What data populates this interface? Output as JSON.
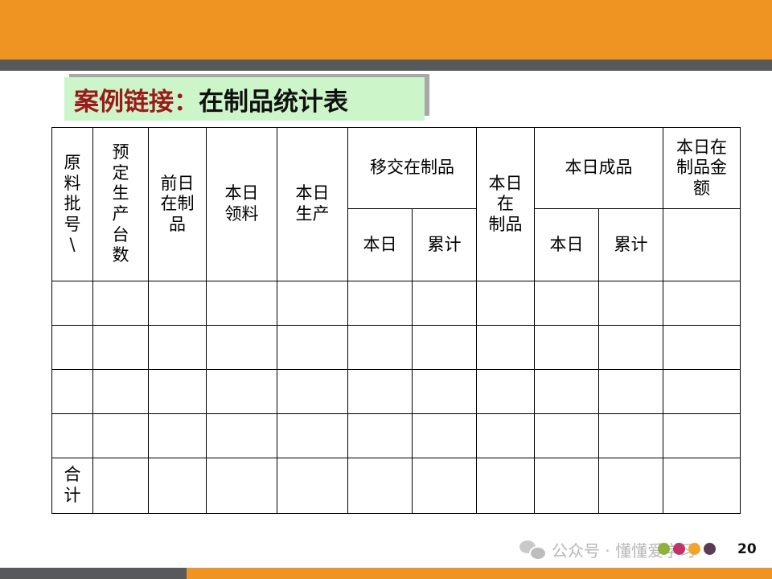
{
  "slide": {
    "title_part1": "案例链接：",
    "title_part2": "在制品统计表",
    "page_number": "20"
  },
  "table": {
    "col_batch": "原\n料\n批\n号\n\\",
    "col_planned": "预\n定\n生\n产\n台\n数",
    "col_prev_wip": "前日\n在制\n品",
    "col_material": "本日\n领料",
    "col_production": "本日\n生产",
    "col_transfer": "移交在制品",
    "col_transfer_today": "本日",
    "col_transfer_total": "累计",
    "col_today_wip": "本日\n在\n制品",
    "col_finished": "本日成品",
    "col_finished_today": "本日",
    "col_finished_total": "累计",
    "col_wip_amount": "本日在\n制品金\n额",
    "total_label": "合\n计"
  },
  "watermark": {
    "text": "公众号 · 懂懂爱学习"
  },
  "colors": {
    "accent_orange": "#ef9322",
    "stripe_gray": "#58595b",
    "title_bg": "#ccf5c9",
    "title_red": "#9b1b1b",
    "dots": [
      "#8db33a",
      "#c2336a",
      "#efa42c",
      "#5b3a55"
    ]
  }
}
